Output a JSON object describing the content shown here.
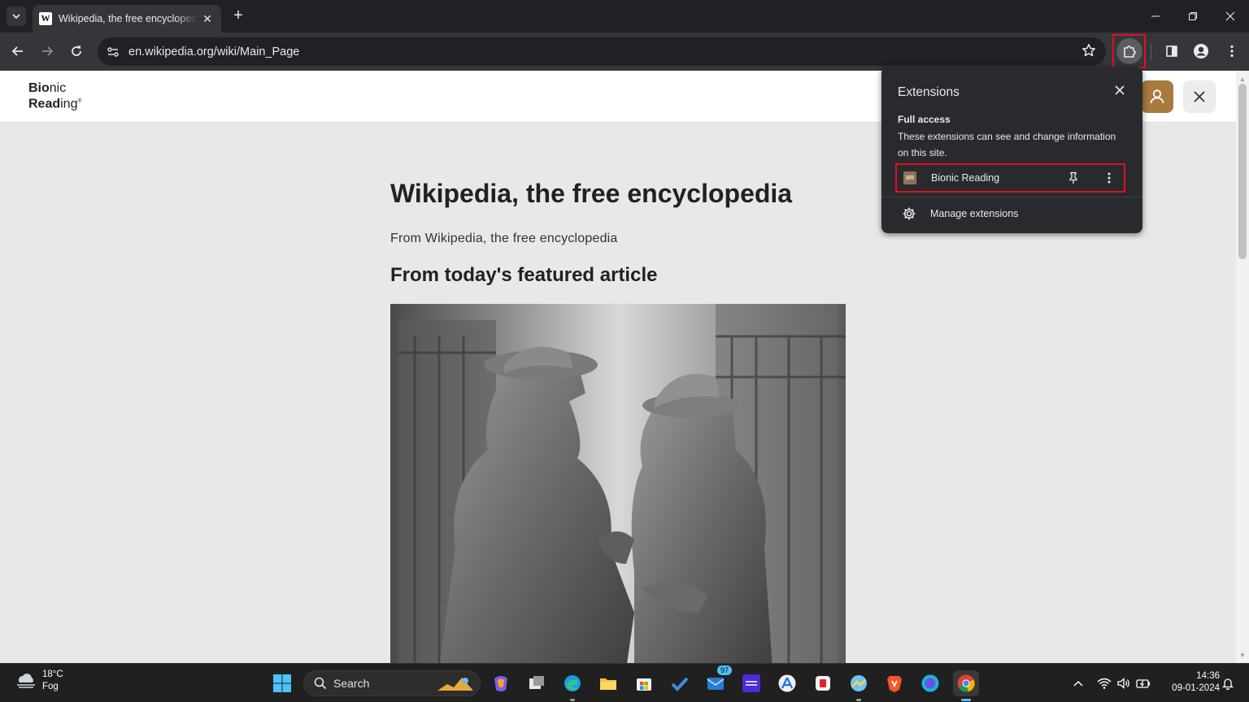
{
  "browser": {
    "tab": {
      "title": "Wikipedia, the free encyclopedia",
      "favicon_letter": "W"
    },
    "url": "en.wikipedia.org/wiki/Main_Page",
    "icons": {
      "tab_search": "chevron-down-icon",
      "back": "back-arrow-icon",
      "forward": "forward-arrow-icon",
      "reload": "reload-icon",
      "bookmark": "star-icon",
      "extensions": "puzzle-icon",
      "side_panel": "side-panel-icon",
      "profile": "profile-icon",
      "menu": "kebab-menu-icon"
    }
  },
  "extensions_popup": {
    "title": "Extensions",
    "full_access_heading": "Full access",
    "full_access_description": "These extensions can see and change information on this site.",
    "extension": {
      "icon_text": "BR",
      "name": "Bionic Reading"
    },
    "manage_label": "Manage extensions",
    "highlight_color": "#e2111b"
  },
  "page": {
    "logo_line1_bold": "Bio",
    "logo_line1_rest": "nic",
    "logo_line2_bold": "Read",
    "logo_line2_rest": "ing",
    "logo_mark": "®",
    "article_title": "Wikipedia, the free encyclopedia",
    "article_subtitle": "From Wikipedia, the free encyclopedia",
    "section_title": "From today's featured article",
    "image_name": "bronze-statue-photo",
    "avatar_color": "#a97a3f"
  },
  "taskbar": {
    "weather_temp": "18°C",
    "weather_condition": "Fog",
    "search_label": "Search",
    "mail_badge": "97",
    "time": "14:36",
    "date": "09-01-2024",
    "apps": [
      "windows-start-icon",
      "search-icon",
      "copilot-icon",
      "task-view-icon",
      "edge-icon",
      "file-explorer-icon",
      "microsoft-store-icon",
      "todo-icon",
      "mail-icon",
      "amazon-music-icon",
      "app-store-icon",
      "app-icon",
      "sky-app-icon",
      "brave-icon",
      "canva-icon",
      "chrome-icon"
    ]
  }
}
